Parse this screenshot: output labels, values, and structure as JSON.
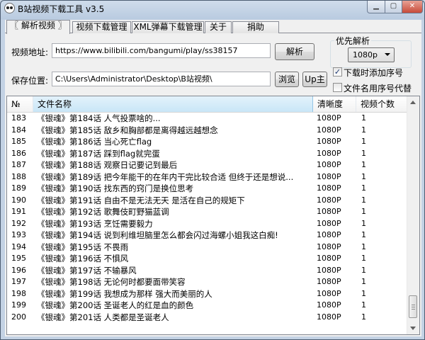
{
  "window": {
    "title": "B站视频下载工具 v3.5"
  },
  "tabs": [
    "〖 解析视频 〗",
    "视频下载管理",
    "XML弹幕下载管理",
    "关于",
    "捐助"
  ],
  "url": {
    "label": "视频地址:",
    "value": "https://www.bilibili.com/bangumi/play/ss38157",
    "parse_label": "解析"
  },
  "save": {
    "label": "保存位置:",
    "value": "C:\\Users\\Administrator\\Desktop\\B站视频\\",
    "browse_label": "浏览",
    "up_label": "Up主"
  },
  "priority": {
    "title": "优先解析",
    "selected": "1080p"
  },
  "options": {
    "add_index_label": "下载时添加序号",
    "add_index_checked": true,
    "use_index_name_label": "文件名用序号代替",
    "use_index_name_checked": false
  },
  "list": {
    "columns": [
      "№",
      "文件名称",
      "清晰度",
      "视频个数"
    ],
    "rows": [
      [
        "183",
        "《银魂》第184话 人气投票啥的...",
        "1080P",
        "1"
      ],
      [
        "184",
        "《银魂》第185话 敌乡和胸部都是离得越远越想念",
        "1080P",
        "1"
      ],
      [
        "185",
        "《银魂》第186话 当心死亡flag",
        "1080P",
        "1"
      ],
      [
        "186",
        "《银魂》第187话 踩到flag就完蛋",
        "1080P",
        "1"
      ],
      [
        "187",
        "《银魂》第188话 观察日记要记到最后",
        "1080P",
        "1"
      ],
      [
        "188",
        "《银魂》第189话 把今年能干的在年内干完比较合适 但终于还是想说...",
        "1080P",
        "1"
      ],
      [
        "189",
        "《银魂》第190话 找东西的窍门是换位思考",
        "1080P",
        "1"
      ],
      [
        "190",
        "《银魂》第191话 自由不是无法无天 是活在自己的规矩下",
        "1080P",
        "1"
      ],
      [
        "191",
        "《银魂》第192话 歌舞伎町野猫蓝调",
        "1080P",
        "1"
      ],
      [
        "192",
        "《银魂》第193话 烹饪需要毅力",
        "1080P",
        "1"
      ],
      [
        "193",
        "《银魂》第194话 说到利维坦脑里怎么都会闪过海螺小姐我这白痴!",
        "1080P",
        "1"
      ],
      [
        "194",
        "《银魂》第195话 不畏雨",
        "1080P",
        "1"
      ],
      [
        "195",
        "《银魂》第196话 不惧风",
        "1080P",
        "1"
      ],
      [
        "196",
        "《银魂》第197话 不输暴风",
        "1080P",
        "1"
      ],
      [
        "197",
        "《银魂》第198话 无论何时都要面带笑容",
        "1080P",
        "1"
      ],
      [
        "198",
        "《银魂》第199话 我想成为那样 强大而美丽的人",
        "1080P",
        "1"
      ],
      [
        "199",
        "《银魂》第200话 圣诞老人的红是血的颜色",
        "1080P",
        "1"
      ],
      [
        "200",
        "《银魂》第201话 人类都是圣诞老人",
        "1080P",
        "1"
      ]
    ]
  }
}
